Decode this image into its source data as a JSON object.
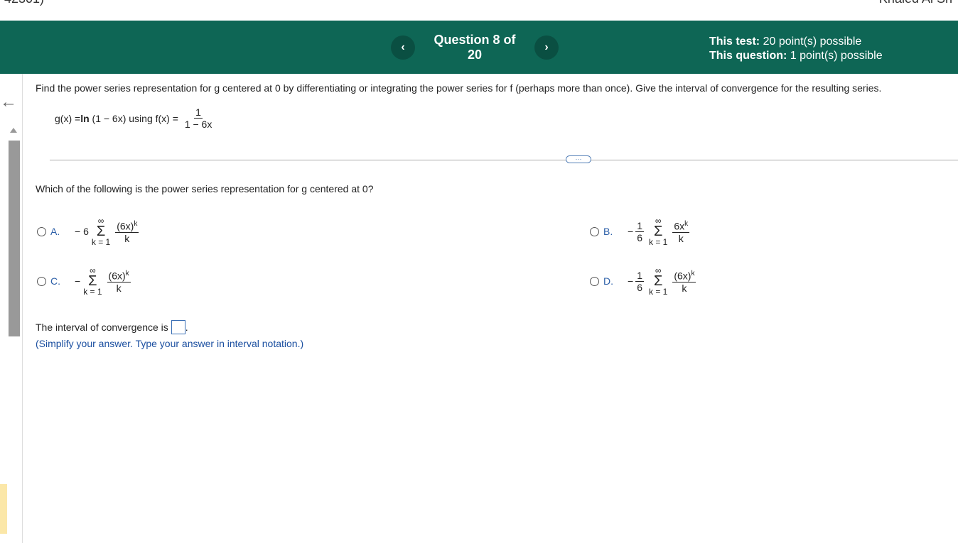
{
  "topbar": {
    "left_fragment": "-42301)",
    "right_fragment": "Khaled Al Sh"
  },
  "header": {
    "prev_icon": "chevron-left-icon",
    "next_icon": "chevron-right-icon",
    "question_label": "Question 8 of 20",
    "test_label": "This test:",
    "test_value": "20 point(s) possible",
    "question_points_label": "This question:",
    "question_points_value": "1 point(s) possible",
    "bg_color": "#0e6655"
  },
  "problem": {
    "prompt": "Find the power series representation for g centered at 0 by differentiating or integrating the power series for f (perhaps more than once). Give the interval of convergence for the resulting series.",
    "g_def": "g(x) = ",
    "ln": "ln",
    "g_arg": " (1 − 6x) using f(x) = ",
    "f_num": "1",
    "f_den": "1 − 6x"
  },
  "question": {
    "text": "Which of the following is the power series representation for g centered at 0?",
    "options": [
      {
        "letter": "A.",
        "coef": "− 6",
        "coef_num": "",
        "coef_den": "",
        "top": "∞",
        "bot": "k = 1",
        "term_num": "(6x)",
        "term_exp": "k",
        "term_den": "k"
      },
      {
        "letter": "B.",
        "coef": "−",
        "coef_num": "1",
        "coef_den": "6",
        "top": "∞",
        "bot": "k = 1",
        "term_num": "6x",
        "term_exp": "k",
        "term_den": "k"
      },
      {
        "letter": "C.",
        "coef": "−",
        "coef_num": "",
        "coef_den": "",
        "top": "∞",
        "bot": "k = 1",
        "term_num": "(6x)",
        "term_exp": "k",
        "term_den": "k"
      },
      {
        "letter": "D.",
        "coef": "−",
        "coef_num": "1",
        "coef_den": "6",
        "top": "∞",
        "bot": "k = 1",
        "term_num": "(6x)",
        "term_exp": "k",
        "term_den": "k"
      }
    ]
  },
  "interval": {
    "label": "The interval of convergence is",
    "period": ".",
    "hint": "(Simplify your answer. Type your answer in interval notation.)"
  },
  "more_button": "···"
}
